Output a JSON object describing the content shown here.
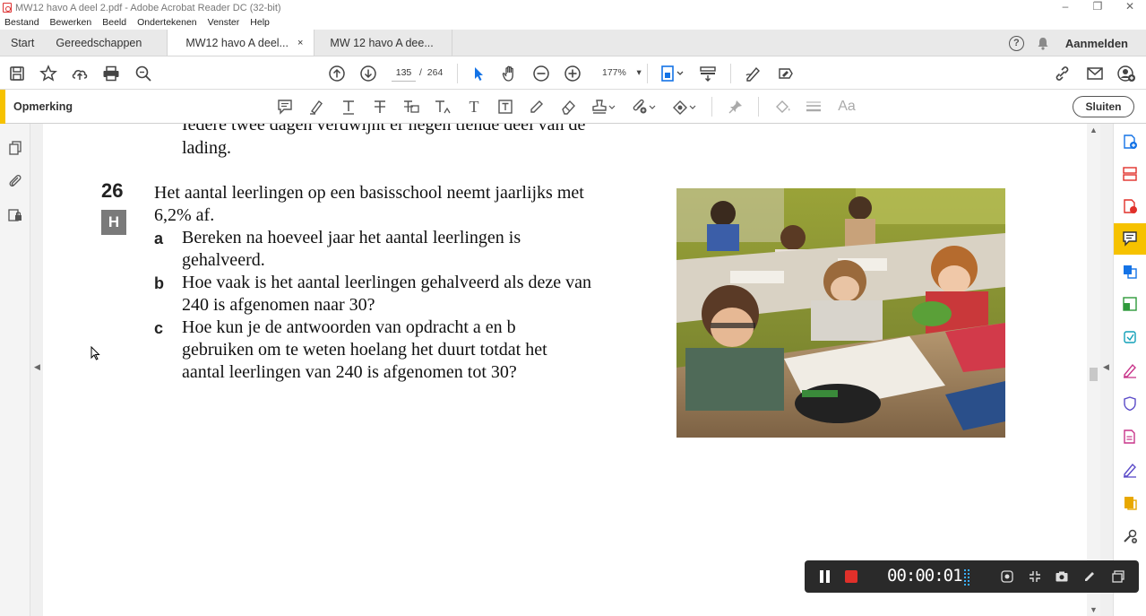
{
  "window": {
    "title": "MW12 havo A deel 2.pdf - Adobe Acrobat Reader DC (32-bit)",
    "controls": [
      "–",
      "❐",
      "✕"
    ]
  },
  "menu": [
    "Bestand",
    "Bewerken",
    "Beeld",
    "Ondertekenen",
    "Venster",
    "Help"
  ],
  "tabs": {
    "home": "Start",
    "tools": "Gereedschappen",
    "docs": [
      {
        "label": "MW12 havo A deel...",
        "active": true,
        "close": "×"
      },
      {
        "label": "MW 12 havo A dee...",
        "active": false
      }
    ],
    "help_glyph": "?",
    "login": "Aanmelden"
  },
  "toolbar": {
    "page_current": "135",
    "page_separator": "/",
    "page_total": "264",
    "zoom": "177%"
  },
  "comment_bar": {
    "label": "Opmerking",
    "close_label": "Sluiten",
    "text_tool_glyphs": [
      "T",
      "T",
      "T"
    ],
    "font_size_glyph": "Aa"
  },
  "document": {
    "prev_lines": [
      "Iedere twee dagen verdwijnt er negen tiende deel van de",
      "lading."
    ],
    "exercise_number": "26",
    "exercise_badge": "H",
    "intro_lines": [
      "Het aantal leerlingen op een basisschool neemt jaarlijks met",
      "6,2% af."
    ],
    "questions": [
      {
        "label": "a",
        "lines": [
          "Bereken na hoeveel jaar het aantal leerlingen is",
          "gehalveerd."
        ]
      },
      {
        "label": "b",
        "lines": [
          "Hoe vaak is het aantal leerlingen gehalveerd als deze van",
          "240 is afgenomen naar 30?"
        ]
      },
      {
        "label": "c",
        "lines": [
          "Hoe kun je de antwoorden van opdracht a en b",
          "gebruiken om te weten hoelang het duurt totdat het",
          "aantal leerlingen van 240 is afgenomen tot 30?"
        ]
      }
    ]
  },
  "recorder": {
    "time": "00:00:01"
  },
  "colors": {
    "accent_yellow": "#f6c200",
    "record_red": "#e0302a"
  }
}
